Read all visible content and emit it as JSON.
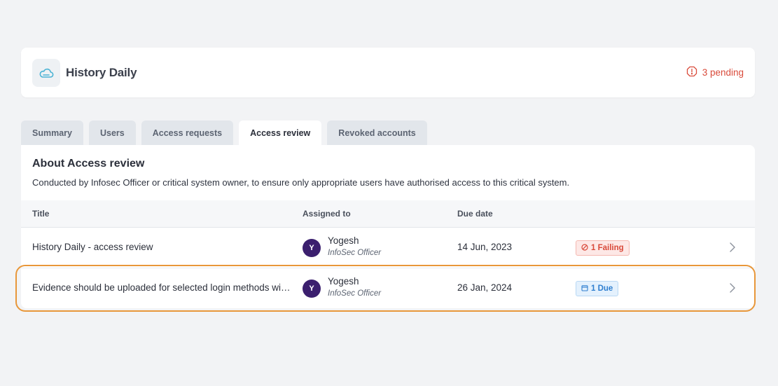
{
  "header": {
    "app_name": "History Daily",
    "pending_label": "3 pending"
  },
  "tabs": [
    {
      "label": "Summary",
      "active": false
    },
    {
      "label": "Users",
      "active": false
    },
    {
      "label": "Access requests",
      "active": false
    },
    {
      "label": "Access review",
      "active": true
    },
    {
      "label": "Revoked accounts",
      "active": false
    }
  ],
  "about": {
    "title": "About Access review",
    "description": "Conducted by Infosec Officer or critical system owner, to ensure only appropriate users have authorised access to this critical system."
  },
  "table": {
    "columns": {
      "title": "Title",
      "assigned_to": "Assigned to",
      "due_date": "Due date"
    },
    "rows": [
      {
        "title": "History Daily - access review",
        "avatar_initial": "Y",
        "assignee_name": "Yogesh",
        "assignee_role": "InfoSec Officer",
        "due_date": "14 Jun, 2023",
        "status": "1 Failing",
        "status_icon": "ban-icon"
      },
      {
        "title": "Evidence should be uploaded for selected login methods within the critical system",
        "avatar_initial": "Y",
        "assignee_name": "Yogesh",
        "assignee_role": "InfoSec Officer",
        "due_date": "26 Jan, 2024",
        "status": "1 Due",
        "status_icon": "calendar-icon"
      }
    ]
  },
  "colors": {
    "accent_cloud": "#4ab3d4",
    "pending_red": "#d94a3a",
    "highlight_orange": "#e8973a",
    "avatar_purple": "#3b1f6e"
  }
}
